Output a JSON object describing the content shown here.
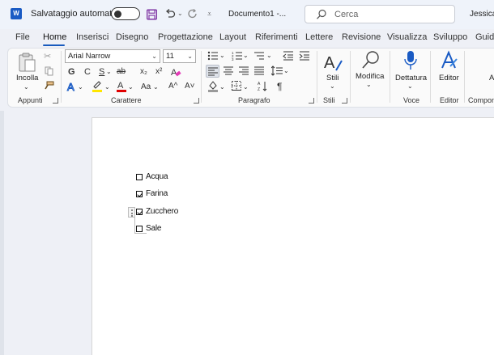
{
  "titlebar": {
    "logo_letter": "W",
    "autosave_label": "Salvataggio automatico",
    "document_title": "Documento1  -...",
    "search_placeholder": "Cerca",
    "user_name": "Jessica I"
  },
  "tabs": [
    {
      "label": "File"
    },
    {
      "label": "Home"
    },
    {
      "label": "Inserisci"
    },
    {
      "label": "Disegno"
    },
    {
      "label": "Progettazione"
    },
    {
      "label": "Layout"
    },
    {
      "label": "Riferimenti"
    },
    {
      "label": "Lettere"
    },
    {
      "label": "Revisione"
    },
    {
      "label": "Visualizza"
    },
    {
      "label": "Sviluppo"
    },
    {
      "label": "Guida"
    }
  ],
  "active_tab": "Home",
  "ribbon": {
    "clipboard": {
      "paste_label": "Incolla",
      "group_label": "Appunti"
    },
    "font": {
      "font_name": "Arial Narrow",
      "font_size": "11",
      "bold": "G",
      "italic": "C",
      "underline": "S",
      "strike": "ab",
      "subscript": "x₂",
      "superscript": "x²",
      "case": "Aa",
      "grow": "A^",
      "shrink": "A˅",
      "group_label": "Carattere"
    },
    "paragraph": {
      "group_label": "Paragrafo",
      "pilcrow": "¶"
    },
    "styles": {
      "label": "Stili",
      "group_label": "Stili"
    },
    "editing": {
      "label": "Modifica"
    },
    "voice": {
      "label": "Dettatura",
      "group_label": "Voce"
    },
    "editor": {
      "label": "Editor",
      "group_label": "Editor"
    },
    "addins": {
      "group_label": "Compon"
    }
  },
  "colors": {
    "accent": "#185abd",
    "highlight": "#ffe600",
    "font_color": "#e00000"
  },
  "document": {
    "checklist": [
      {
        "label": "Acqua",
        "checked": false
      },
      {
        "label": "Farina",
        "checked": true
      },
      {
        "label": "Zucchero",
        "checked": true
      },
      {
        "label": "Sale",
        "checked": false
      }
    ]
  }
}
